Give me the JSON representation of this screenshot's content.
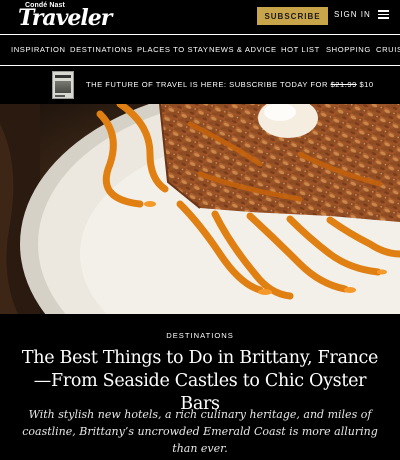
{
  "header": {
    "logo_small": "Condé Nast",
    "logo_main": "Traveler",
    "subscribe_label": "SUBSCRIBE",
    "signin_label": "SIGN IN",
    "menu_icon": "hamburger-menu-icon"
  },
  "nav": {
    "items": [
      "INSPIRATION",
      "DESTINATIONS",
      "PLACES TO STAY",
      "NEWS & ADVICE",
      "HOT LIST",
      "SHOPPING",
      "CRUIS"
    ]
  },
  "promo": {
    "text": "THE FUTURE OF TRAVEL IS HERE: SUBSCRIBE TODAY FOR",
    "old_price": "$21.99",
    "new_price": "$10"
  },
  "hero": {
    "icon": "hero-food-photo",
    "colors": {
      "plate": "#ece8df",
      "crepe": "#a8582a",
      "caramel": "#e07f12",
      "background": "#1a1410"
    }
  },
  "article": {
    "eyebrow": "DESTINATIONS",
    "headline": "The Best Things to Do in Brittany, France—From Seaside Castles to Chic Oyster Bars",
    "dek": "With stylish new hotels, a rich culinary heritage, and miles of coastline, Brittany’s uncrowded Emerald Coast is more alluring than ever."
  }
}
